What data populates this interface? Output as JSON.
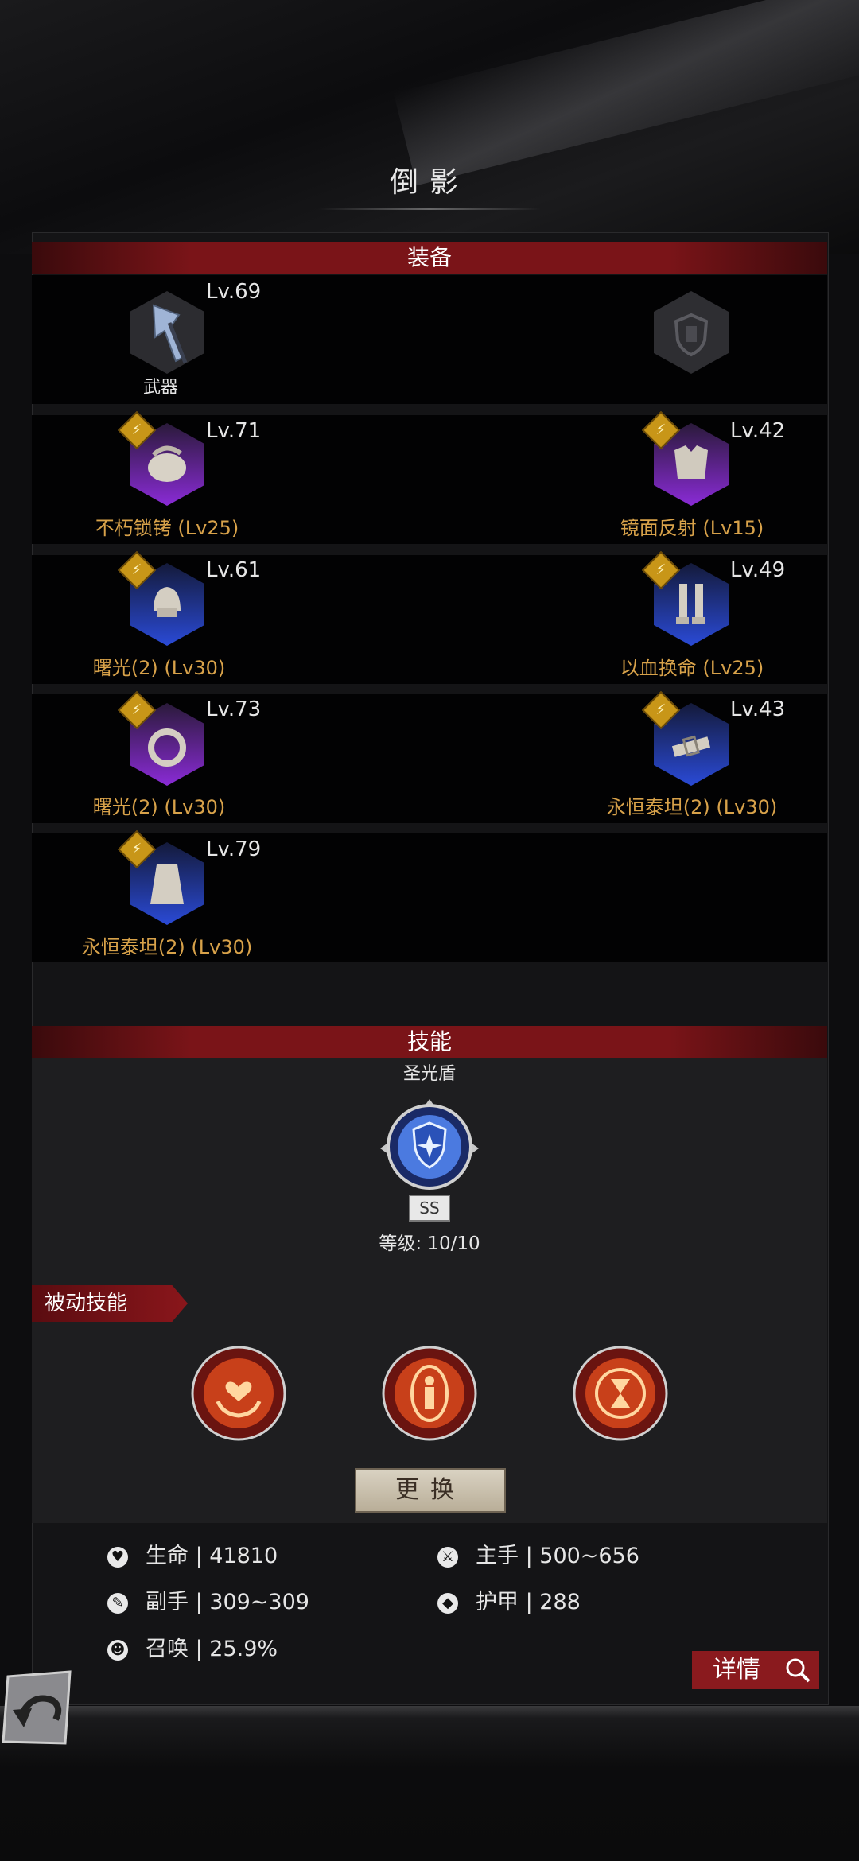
{
  "page": {
    "title": "倒影"
  },
  "equipment": {
    "header": "装备",
    "weapon": {
      "level": "Lv.69",
      "label": "武器"
    },
    "items": [
      {
        "level": "Lv.71",
        "name": "不朽锁铐 (Lv25)"
      },
      {
        "level": "Lv.42",
        "name": "镜面反射 (Lv15)"
      },
      {
        "level": "Lv.61",
        "name": "曙光(2) (Lv30)"
      },
      {
        "level": "Lv.49",
        "name": "以血换命 (Lv25)"
      },
      {
        "level": "Lv.73",
        "name": "曙光(2) (Lv30)"
      },
      {
        "level": "Lv.43",
        "name": "永恒泰坦(2) (Lv30)"
      },
      {
        "level": "Lv.79",
        "name": "永恒泰坦(2) (Lv30)"
      }
    ]
  },
  "skills": {
    "header": "技能",
    "active": {
      "name": "圣光盾",
      "grade": "SS",
      "level": "等级: 10/10"
    },
    "passive_label": "被动技能",
    "change_button": "更换"
  },
  "stats": [
    {
      "label": "生命",
      "value": "41810",
      "icon": "heart-icon"
    },
    {
      "label": "主手",
      "value": "500~656",
      "icon": "sword-icon"
    },
    {
      "label": "副手",
      "value": "309~309",
      "icon": "offhand-icon"
    },
    {
      "label": "护甲",
      "value": "288",
      "icon": "armor-icon"
    },
    {
      "label": "召唤",
      "value": "25.9%",
      "icon": "summon-icon"
    }
  ],
  "detail_button": "详情",
  "colors": {
    "accent_red": "#8a1a1e",
    "item_name": "#d8a24a",
    "purple_rarity": "#8a2bd6",
    "blue_rarity": "#2a4ad6",
    "badge_gold": "#c89618"
  }
}
